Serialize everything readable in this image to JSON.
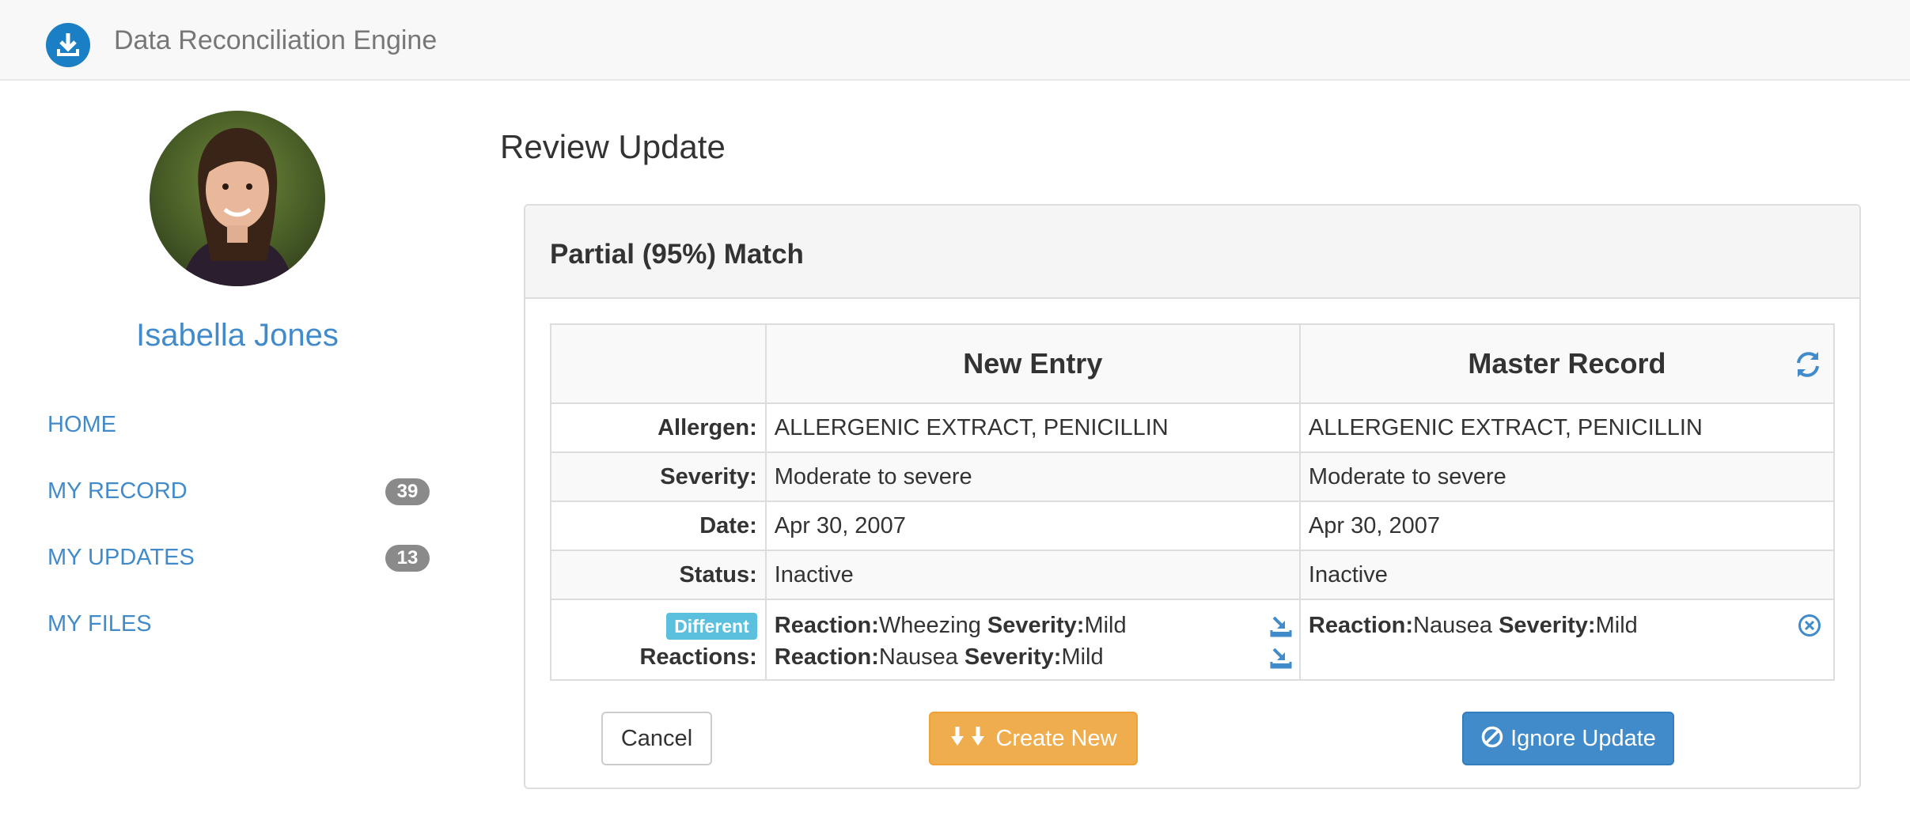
{
  "navbar": {
    "brand": "Data Reconciliation Engine",
    "brand_icon": "download-icon"
  },
  "sidebar": {
    "user_name": "Isabella Jones",
    "items": [
      {
        "label": "HOME",
        "badge": null
      },
      {
        "label": "MY RECORD",
        "badge": "39"
      },
      {
        "label": "MY UPDATES",
        "badge": "13"
      },
      {
        "label": "MY FILES",
        "badge": null
      }
    ]
  },
  "main": {
    "page_title": "Review Update",
    "panel_title": "Partial (95%) Match",
    "columns": [
      "New Entry",
      "Master Record"
    ],
    "rows": [
      {
        "label": "Allergen:",
        "new": "ALLERGENIC EXTRACT, PENICILLIN",
        "master": "ALLERGENIC EXTRACT, PENICILLIN"
      },
      {
        "label": "Severity:",
        "new": "Moderate to severe",
        "master": "Moderate to severe"
      },
      {
        "label": "Date:",
        "new": "Apr 30, 2007",
        "master": "Apr 30, 2007"
      },
      {
        "label": "Status:",
        "new": "Inactive",
        "master": "Inactive"
      }
    ],
    "reactions": {
      "badge": "Different",
      "label": "Reactions:",
      "reaction_key": "Reaction:",
      "severity_key": "Severity:",
      "new": [
        {
          "reaction": "Wheezing",
          "severity": "Mild"
        },
        {
          "reaction": "Nausea",
          "severity": "Mild"
        }
      ],
      "master": [
        {
          "reaction": "Nausea",
          "severity": "Mild"
        }
      ]
    },
    "buttons": {
      "cancel": "Cancel",
      "create": "Create New",
      "ignore": "Ignore Update"
    }
  },
  "colors": {
    "link": "#428bca",
    "brand_icon": "#1a7fc4",
    "warning": "#f0ad4e",
    "primary": "#428bca",
    "info": "#5bc0de",
    "badge": "#8a8a8a"
  }
}
